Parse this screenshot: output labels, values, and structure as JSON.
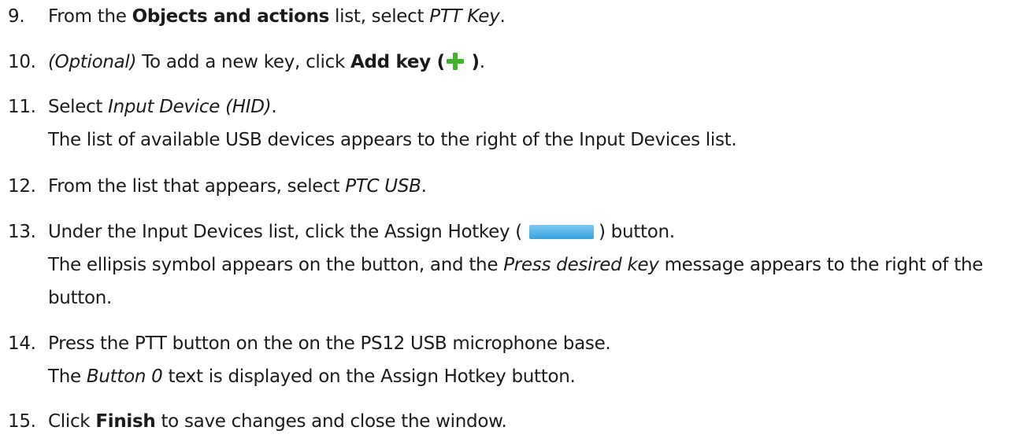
{
  "steps": [
    {
      "number": "9.",
      "line1": {
        "t1": "From the ",
        "b1": "Objects and actions",
        "t2": " list, select ",
        "i1": "PTT Key",
        "t3": "."
      }
    },
    {
      "number": "10.",
      "line1": {
        "i1": "(Optional)",
        "t1": " To add a new key, click ",
        "b1": "Add key (",
        "icon": "plus-icon",
        "b2": " )",
        "t2": "."
      }
    },
    {
      "number": "11.",
      "line1": {
        "t1": "Select ",
        "i1": "Input Device (HID)",
        "t2": "."
      },
      "line2": "The list of available USB devices appears to the right of the Input Devices list."
    },
    {
      "number": "12.",
      "line1": {
        "t1": "From the list that appears, select ",
        "i1": "PTC USB",
        "t2": "."
      }
    },
    {
      "number": "13.",
      "line1": {
        "t1": "Under the Input Devices list, click the Assign Hotkey ( ",
        "icon": "assign-hotkey-button-icon",
        "t2": ") button."
      },
      "line2": {
        "t1": "The ellipsis symbol appears on the button, and the ",
        "i1": "Press desired key",
        "t2": " message appears to the right of the"
      },
      "line3": "button."
    },
    {
      "number": "14.",
      "line1": "Press the PTT button on the on the PS12 USB microphone base.",
      "line2": {
        "t1": "The ",
        "i1": "Button 0",
        "t2": " text is displayed on the Assign Hotkey button."
      }
    },
    {
      "number": "15.",
      "line1": {
        "t1": "Click ",
        "b1": "Finish",
        "t2": " to save changes and close the window."
      }
    }
  ],
  "colors": {
    "text": "#1b1b1b",
    "plus_icon": "#3fb328",
    "hotkey_button": "#5ab6e8"
  }
}
